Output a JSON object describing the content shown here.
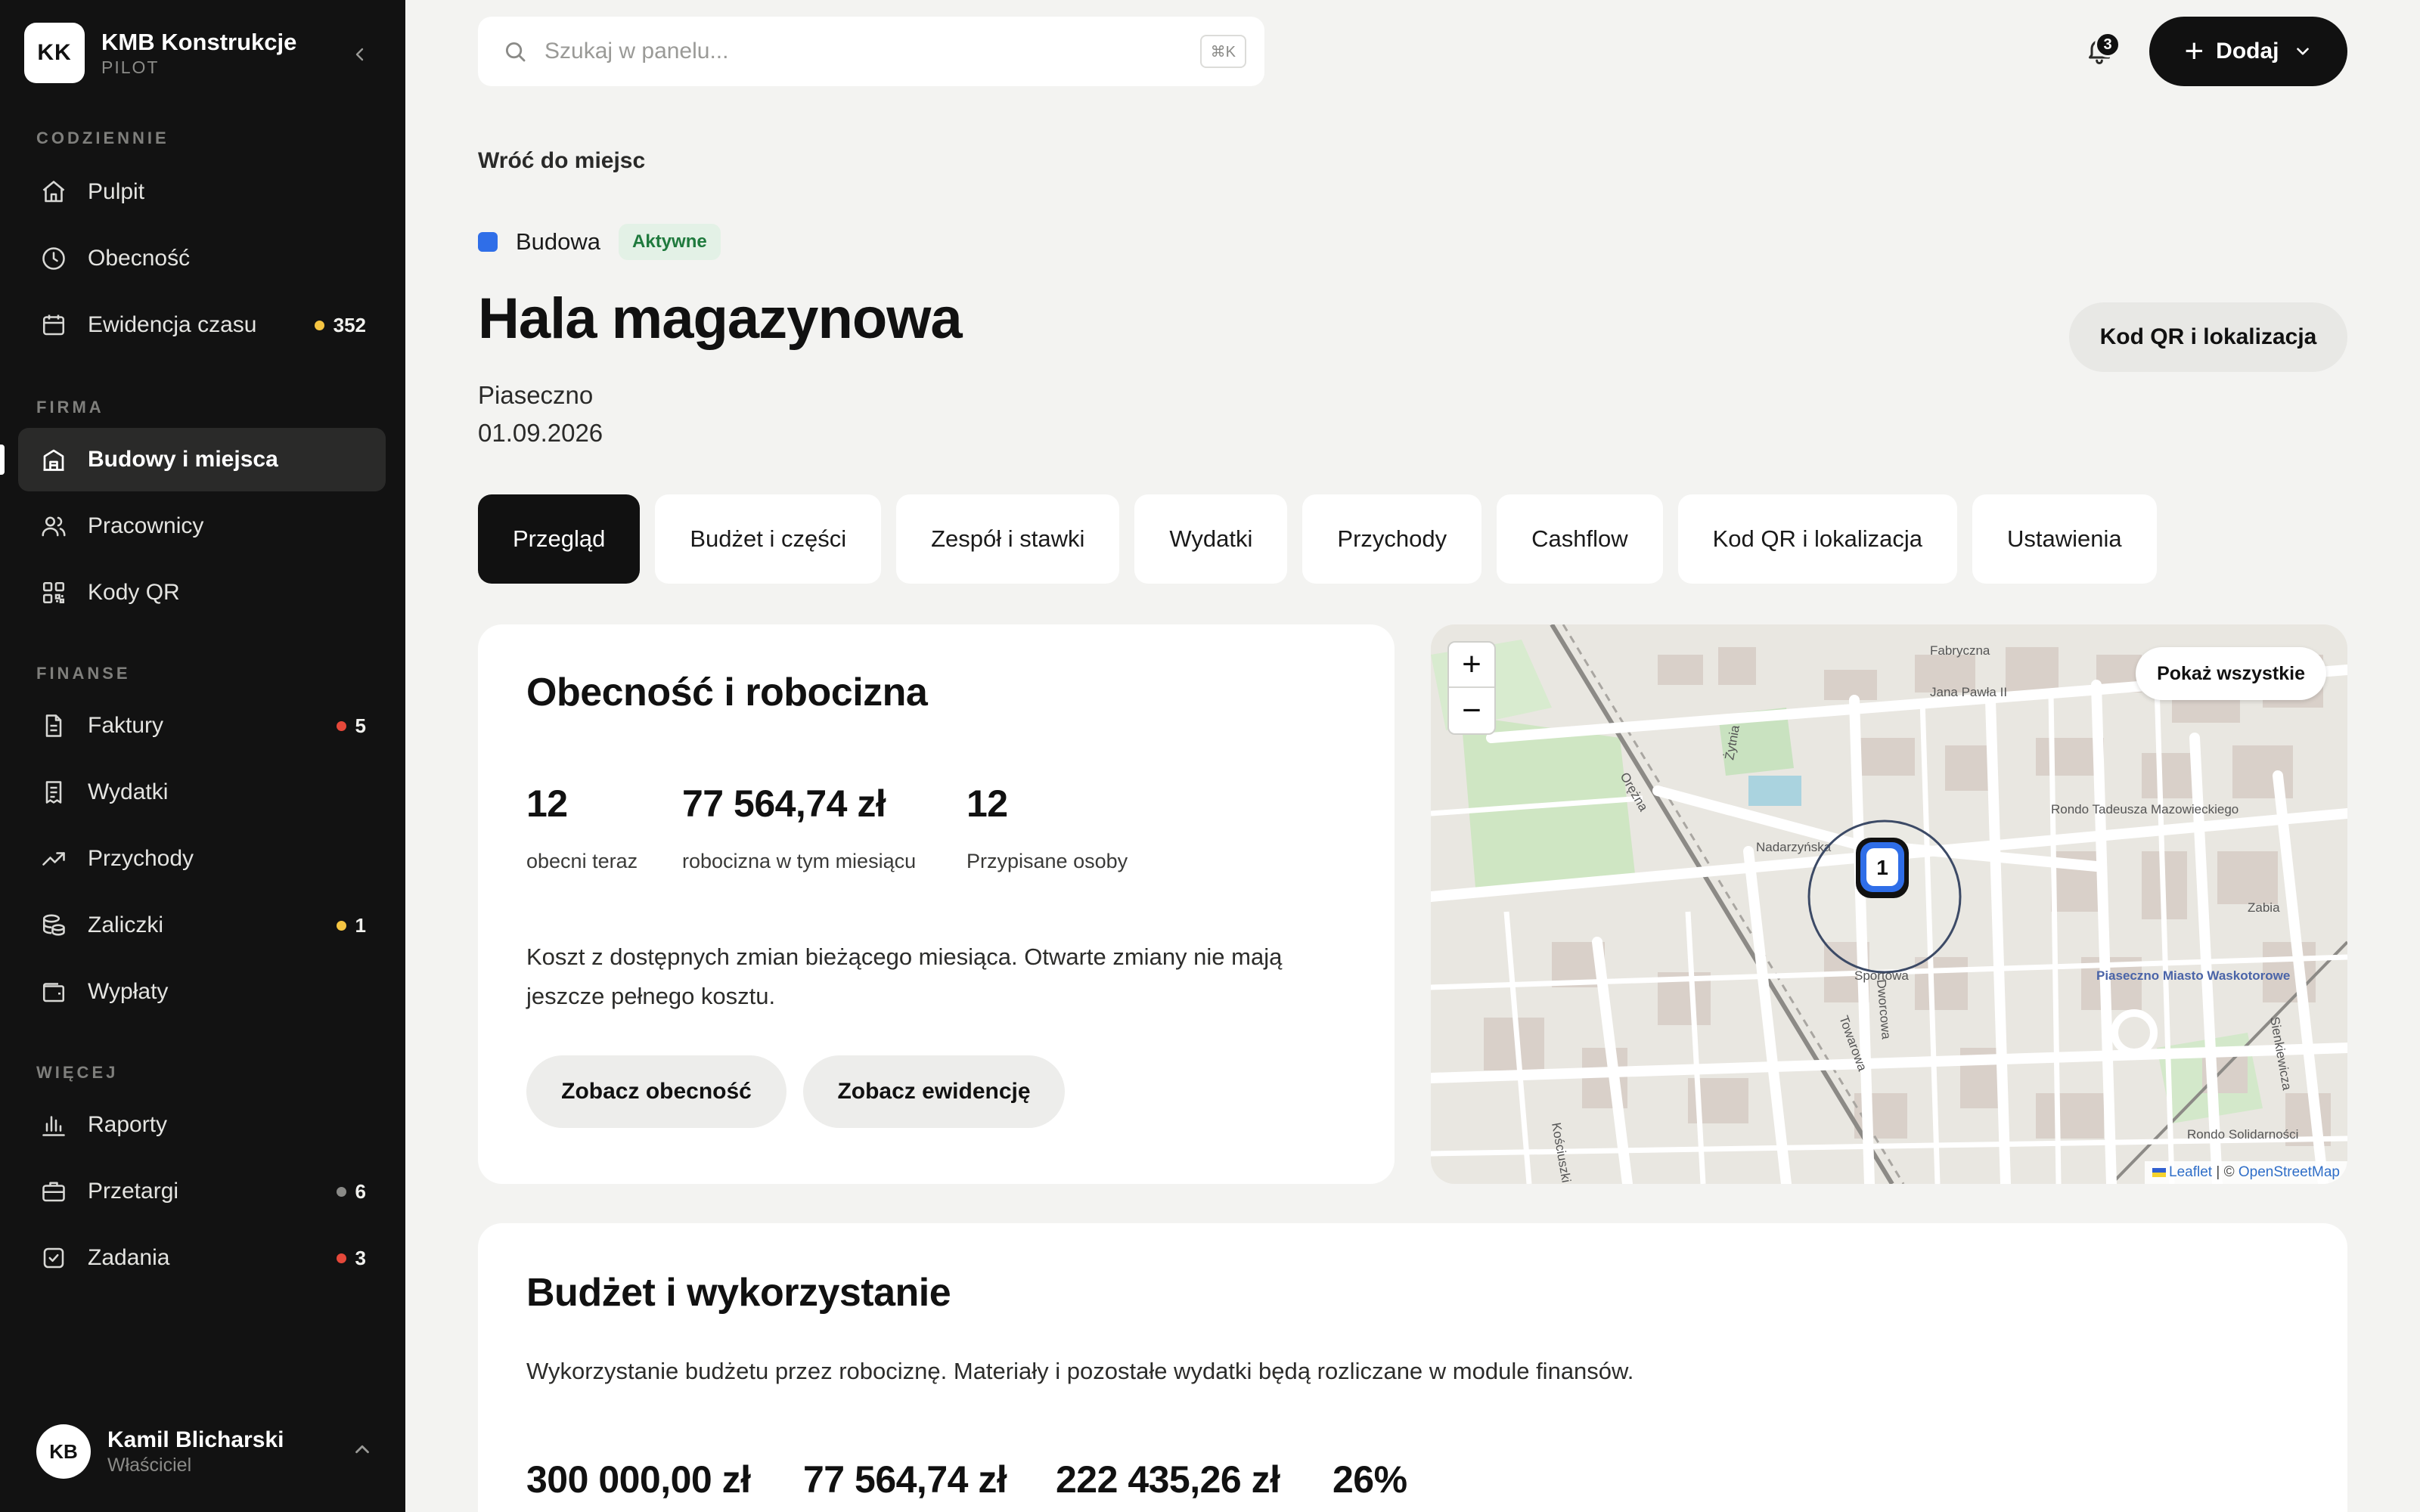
{
  "brand": {
    "initials": "KK",
    "name": "KMB Konstrukcje",
    "plan": "PILOT"
  },
  "sidebar": {
    "sections": [
      {
        "label": "CODZIENNIE"
      },
      {
        "label": "FIRMA"
      },
      {
        "label": "FINANSE"
      },
      {
        "label": "WIĘCEJ"
      }
    ],
    "items": [
      {
        "label": "Pulpit",
        "icon": "home-icon"
      },
      {
        "label": "Obecność",
        "icon": "clock-icon"
      },
      {
        "label": "Ewidencja czasu",
        "icon": "calendar-icon",
        "badge": "352",
        "badge_color": "#f5c542"
      },
      {
        "label": "Budowy i miejsca",
        "icon": "building-icon",
        "active": true
      },
      {
        "label": "Pracownicy",
        "icon": "users-icon"
      },
      {
        "label": "Kody QR",
        "icon": "qr-icon"
      },
      {
        "label": "Faktury",
        "icon": "invoice-icon",
        "badge": "5",
        "badge_color": "#e5483a"
      },
      {
        "label": "Wydatki",
        "icon": "receipt-icon"
      },
      {
        "label": "Przychody",
        "icon": "trend-up-icon"
      },
      {
        "label": "Zaliczki",
        "icon": "coins-icon",
        "badge": "1",
        "badge_color": "#f5c542"
      },
      {
        "label": "Wypłaty",
        "icon": "wallet-icon"
      },
      {
        "label": "Raporty",
        "icon": "bar-chart-icon"
      },
      {
        "label": "Przetargi",
        "icon": "briefcase-icon",
        "badge": "6",
        "badge_color": "#8a8a87"
      },
      {
        "label": "Zadania",
        "icon": "checkbox-icon",
        "badge": "3",
        "badge_color": "#e5483a"
      }
    ]
  },
  "user": {
    "initials": "KB",
    "name": "Kamil Blicharski",
    "role": "Właściciel"
  },
  "topbar": {
    "search_placeholder": "Szukaj w panelu...",
    "shortcut": "⌘K",
    "notifications": "3",
    "add_label": "Dodaj"
  },
  "header": {
    "back_label": "Wróć do miejsc",
    "type_label": "Budowa",
    "type_color": "#2f6ee8",
    "status": "Aktywne",
    "title": "Hala magazynowa",
    "city": "Piaseczno",
    "date": "01.09.2026",
    "qr_button": "Kod QR i lokalizacja"
  },
  "tabs": [
    {
      "label": "Przegląd",
      "active": true
    },
    {
      "label": "Budżet i części"
    },
    {
      "label": "Zespół i stawki"
    },
    {
      "label": "Wydatki"
    },
    {
      "label": "Przychody"
    },
    {
      "label": "Cashflow"
    },
    {
      "label": "Kod QR i lokalizacja"
    },
    {
      "label": "Ustawienia"
    }
  ],
  "attendance": {
    "title": "Obecność i robocizna",
    "stats": [
      {
        "value": "12",
        "label": "obecni teraz"
      },
      {
        "value": "77 564,74 zł",
        "label": "robocizna w tym miesiącu"
      },
      {
        "value": "12",
        "label": "Przypisane osoby"
      }
    ],
    "description": "Koszt z dostępnych zmian bieżącego miesiąca. Otwarte zmiany nie mają jeszcze pełnego kosztu.",
    "buttons": [
      "Zobacz obecność",
      "Zobacz ewidencję"
    ]
  },
  "map": {
    "zoom_in": "+",
    "zoom_out": "−",
    "show_all": "Pokaż wszystkie",
    "cluster_count": "1",
    "attribution_leaflet": "Leaflet",
    "attribution_sep": " | © ",
    "attribution_osm": "OpenStreetMap",
    "street_labels": [
      "Jana Pawła II",
      "Fabryczna",
      "Żytnia",
      "Orężna",
      "Nadarzyńska",
      "Sportowa",
      "Towarowa",
      "Dworcowa",
      "Rondo Tadeusza Mazowieckiego",
      "Piaseczno Miasto Waskotorowe",
      "Rondo Solidarności",
      "Zabia",
      "Kościuszki",
      "Sienkiewicza"
    ]
  },
  "budget": {
    "title": "Budżet i wykorzystanie",
    "description": "Wykorzystanie budżetu przez robociznę. Materiały i pozostałe wydatki będą rozliczane w module finansów.",
    "stats": [
      "300 000,00 zł",
      "77 564,74 zł",
      "222 435,26 zł",
      "26%"
    ]
  }
}
